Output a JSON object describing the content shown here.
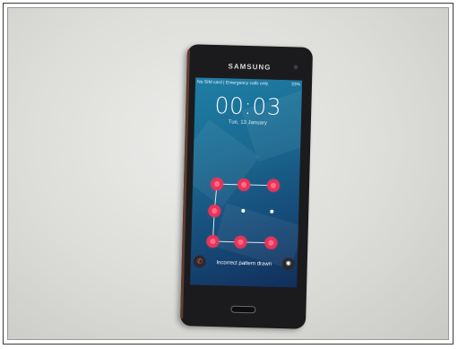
{
  "phone": {
    "brand": "SAMSUNG",
    "status_left": "No SIM card | Emergency calls only",
    "status_right": "33%",
    "time": "00:03",
    "date": "Tue, 13 January",
    "message": "Incorrect pattern drawn"
  },
  "icons": {
    "call": "phone-icon",
    "camera": "camera-icon"
  },
  "colors": {
    "pattern_dot": "#e8345a",
    "screen_top": "#1f7fa6",
    "screen_bottom": "#122e5a"
  }
}
